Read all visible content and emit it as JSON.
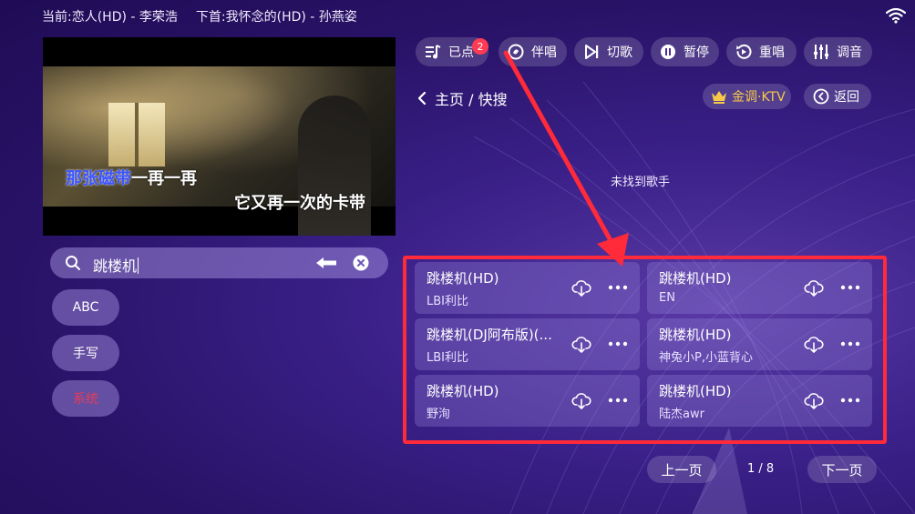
{
  "now_playing": {
    "current_label": "当前:",
    "current_song": "恋人(HD) - 李荣浩",
    "next_label": "下首:",
    "next_song": "我怀念的(HD) - 孙燕姿"
  },
  "video": {
    "lyric_line1_sung": "那张磁带",
    "lyric_line1_rest": "一再一再",
    "lyric_line2": "它又再一次的卡带"
  },
  "toolbar": {
    "queued_label": "已点",
    "queued_count": "2",
    "accompany_label": "伴唱",
    "skip_label": "切歌",
    "pause_label": "暂停",
    "replay_label": "重唱",
    "tune_label": "调音"
  },
  "breadcrumb": {
    "text": "主页 / 快搜"
  },
  "brand": {
    "label": "金调·KTV",
    "color": "#f7c948"
  },
  "back_button": {
    "label": "返回"
  },
  "search": {
    "value": "跳楼机"
  },
  "keyboard_modes": [
    {
      "label": "ABC"
    },
    {
      "label": "手写"
    },
    {
      "label": "系统"
    }
  ],
  "artist_result_message": "未找到歌手",
  "results": [
    {
      "title": "跳楼机(HD)",
      "artist": "LBI利比"
    },
    {
      "title": "跳楼机(HD)",
      "artist": "EN"
    },
    {
      "title": "跳楼机(DJ阿布版)(...",
      "artist": "LBI利比"
    },
    {
      "title": "跳楼机(HD)",
      "artist": "神兔小P,小蓝背心"
    },
    {
      "title": "跳楼机(HD)",
      "artist": "野洵"
    },
    {
      "title": "跳楼机(HD)",
      "artist": "陆杰awr"
    }
  ],
  "pagination": {
    "prev_label": "上一页",
    "page_text": "1 / 8",
    "next_label": "下一页"
  },
  "colors": {
    "highlight_frame": "#ff2a3a",
    "badge": "#ff3a52",
    "sung_lyric": "#3b54ff",
    "active_mode": "#e73c5a"
  }
}
